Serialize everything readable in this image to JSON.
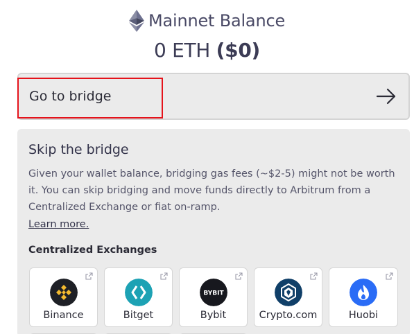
{
  "balance": {
    "title": "Mainnet Balance",
    "amount": "0 ETH",
    "usd": "($0)"
  },
  "bridge_button": {
    "label": "Go to bridge",
    "icon": "arrow-right-icon"
  },
  "skip_panel": {
    "title": "Skip the bridge",
    "description": "Given your wallet balance, bridging gas fees (~$2-5) might not be worth it. You can skip bridging and move funds directly to Arbitrum from a Centralized Exchange or fiat on-ramp.",
    "learn_more": "Learn more.",
    "cex_heading": "Centralized Exchanges",
    "exchanges": [
      {
        "name": "Binance",
        "icon": "binance-logo"
      },
      {
        "name": "Bitget",
        "icon": "bitget-logo"
      },
      {
        "name": "Bybit",
        "icon": "bybit-logo",
        "logo_text": "BYBIT"
      },
      {
        "name": "Crypto.com",
        "icon": "crypto-com-logo"
      },
      {
        "name": "Huobi",
        "icon": "huobi-logo"
      }
    ]
  },
  "colors": {
    "highlight": "#e5131b",
    "panel_bg": "#ebebeb",
    "binance": "#f3ba2f",
    "bitget": "#1da2b4",
    "bybit": "#17181e",
    "crypto_com": "#103f68",
    "huobi": "#2a6cf6"
  }
}
